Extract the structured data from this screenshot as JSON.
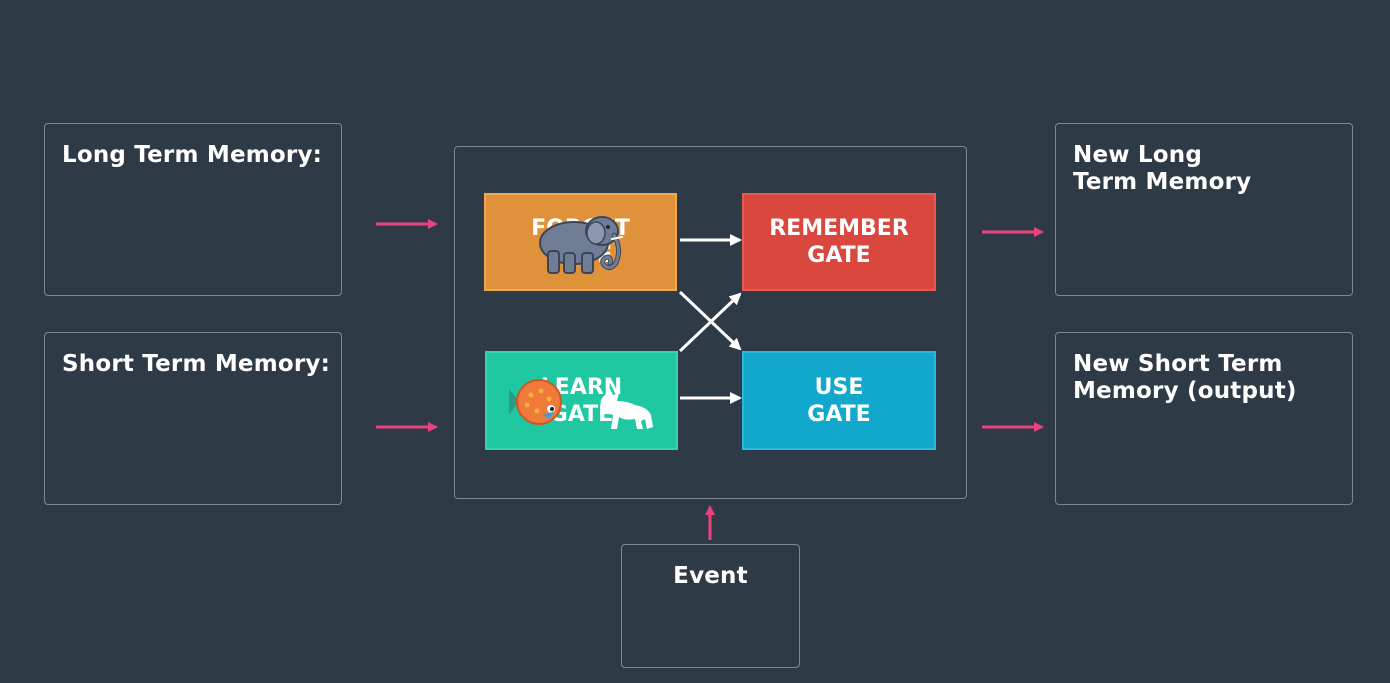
{
  "inputs": {
    "long_term_memory": "Long Term Memory:",
    "short_term_memory": "Short Term Memory:"
  },
  "outputs": {
    "new_long_term_memory": "New Long\nTerm Memory",
    "new_short_term_memory": "New Short Term\nMemory (output)"
  },
  "event": "Event",
  "gates": {
    "forget": "FORGET\nGATE",
    "remember": "REMEMBER\nGATE",
    "learn": "LEARN\nGATE",
    "use": "USE\nGATE"
  },
  "icons": {
    "forget": "elephant-icon",
    "learn_fish": "fish-icon",
    "learn_wolf": "wolf-icon"
  },
  "colors": {
    "background": "#2f3a47",
    "forget": "#e0923a",
    "remember": "#d9473e",
    "learn": "#1fc8a3",
    "use": "#12a8cc",
    "input_arrow": "#e8437e",
    "internal_arrow": "#ffffff"
  }
}
